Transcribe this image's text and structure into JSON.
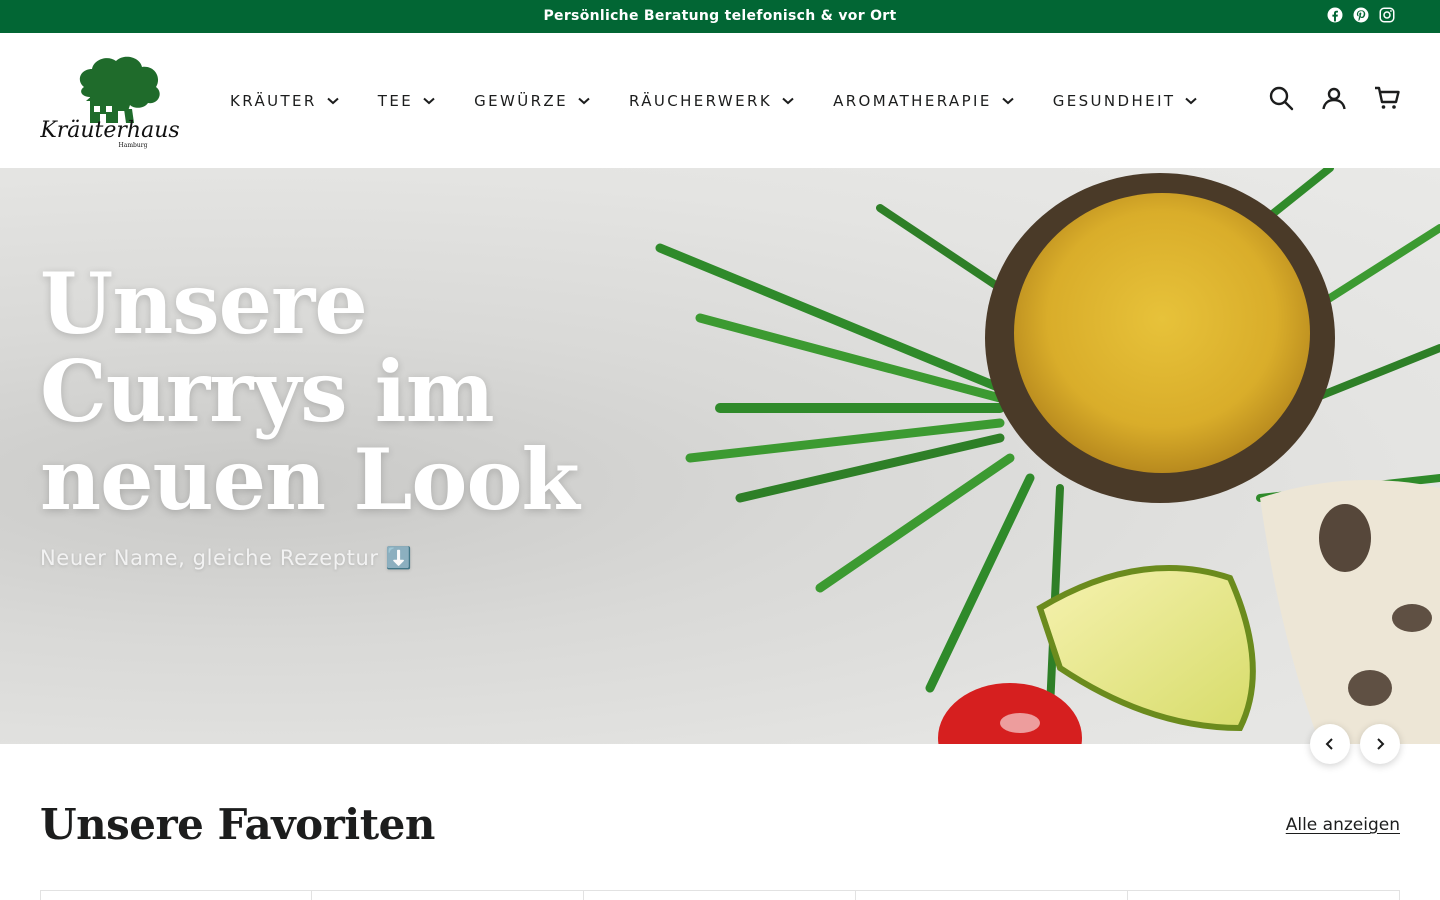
{
  "announcement": {
    "text": "Persönliche Beratung telefonisch & vor Ort",
    "background": "#026634",
    "social": [
      "facebook-icon",
      "pinterest-icon",
      "instagram-icon"
    ]
  },
  "header": {
    "logo_text": "Kräuterhaus",
    "logo_subtext": "Hamburg",
    "nav": [
      {
        "label": "KRÄUTER"
      },
      {
        "label": "TEE"
      },
      {
        "label": "GEWÜRZE"
      },
      {
        "label": "RÄUCHERWERK"
      },
      {
        "label": "AROMATHERAPIE"
      },
      {
        "label": "GESUNDHEIT"
      }
    ],
    "tools": [
      "search-icon",
      "account-icon",
      "cart-icon"
    ]
  },
  "hero": {
    "title": "Unsere Currys im neuen Look",
    "subtitle": "Neuer Name, gleiche Rezeptur ⬇️",
    "controls": [
      "chevron-left-icon",
      "chevron-right-icon"
    ]
  },
  "favorites": {
    "title": "Unsere Favoriten",
    "link": "Alle anzeigen"
  },
  "colors": {
    "brand_green": "#026634",
    "text": "#1c1d1d"
  }
}
